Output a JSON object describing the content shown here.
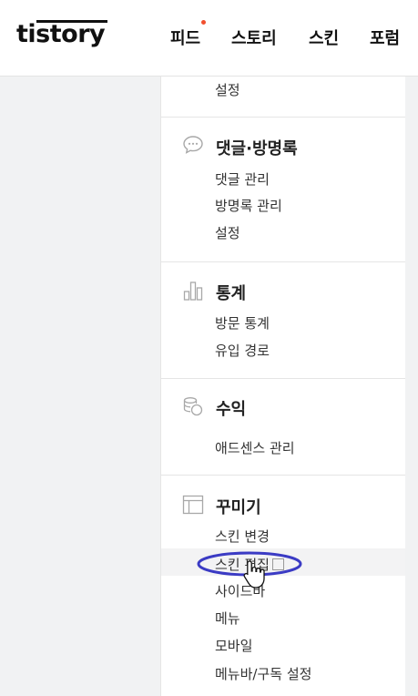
{
  "header": {
    "logo_text": "tistory",
    "nav": [
      {
        "label": "피드"
      },
      {
        "label": "스토리"
      },
      {
        "label": "스킨"
      },
      {
        "label": "포럼"
      }
    ]
  },
  "sidebar": {
    "top_item": "설정",
    "sections": [
      {
        "title": "댓글·방명록",
        "icon": "comment-icon",
        "items": [
          "댓글 관리",
          "방명록 관리",
          "설정"
        ]
      },
      {
        "title": "통계",
        "icon": "bar-chart-icon",
        "items": [
          "방문 통계",
          "유입 경로"
        ]
      },
      {
        "title": "수익",
        "icon": "coins-icon",
        "items": [
          "애드센스 관리"
        ]
      },
      {
        "title": "꾸미기",
        "icon": "layout-icon",
        "items": [
          "스킨 변경",
          "스킨 편집",
          "사이드바",
          "메뉴",
          "모바일",
          "메뉴바/구독 설정"
        ]
      }
    ]
  },
  "colors": {
    "notification_dot": "#f14f2e",
    "annotation_ellipse": "#3b3bc4",
    "gutter": "#f1f2f3"
  }
}
